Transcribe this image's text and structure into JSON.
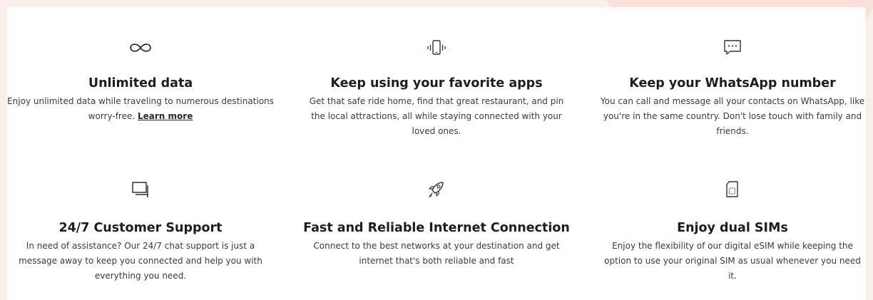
{
  "features": [
    {
      "icon": "infinity-icon",
      "title": "Unlimited data",
      "desc": "Enjoy unlimited data while traveling to numerous destinations worry-free.",
      "link": "Learn more"
    },
    {
      "icon": "phone-vibrate-icon",
      "title": "Keep using your favorite apps",
      "desc": "Get that safe ride home, find that great restaurant, and pin the local attractions, all while staying connected with your loved ones."
    },
    {
      "icon": "chat-bubble-icon",
      "title": "Keep your WhatsApp number",
      "desc": "You can call and message all your contacts on WhatsApp, like you're in the same country. Don't lose touch with family and friends."
    },
    {
      "icon": "support-chat-icon",
      "title": "24/7 Customer Support",
      "desc": "In need of assistance? Our 24/7 chat support is just a message away to keep you connected and help you with everything you need."
    },
    {
      "icon": "rocket-icon",
      "title": "Fast and Reliable Internet Connection",
      "desc": "Connect to the best networks at your destination and get internet that's both reliable and fast"
    },
    {
      "icon": "sim-card-icon",
      "title": "Enjoy dual SIMs",
      "desc": "Enjoy the flexibility of our digital eSIM while keeping the option to use your original SIM as usual whenever you need it."
    }
  ]
}
